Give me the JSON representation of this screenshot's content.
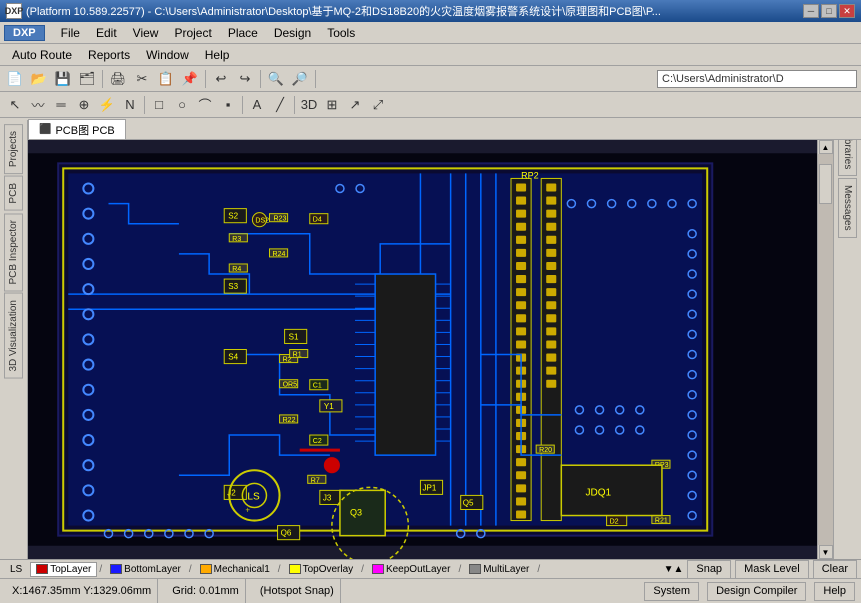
{
  "titlebar": {
    "text": "(Platform 10.589.22577) - C:\\Users\\Administrator\\Desktop\\基于MQ-2和DS18B20的火灾温度烟雾报警系统设计\\原理图和PCB图\\P...",
    "app_icon": "DXP",
    "min_btn": "─",
    "max_btn": "□",
    "close_btn": "✕"
  },
  "menubar": {
    "items": [
      "File",
      "Edit",
      "View",
      "Project",
      "Place",
      "Design",
      "Tools"
    ]
  },
  "dxp": {
    "label": "DXP"
  },
  "menu2": {
    "items": [
      "Auto Route",
      "Reports",
      "Window",
      "Help"
    ]
  },
  "tab": {
    "icon": "⬛",
    "label": "PCB图 PCB"
  },
  "left_panel": {
    "tabs": [
      "Projects",
      "PCB",
      "PCB Inspector",
      "3D Visualization"
    ]
  },
  "right_panel": {
    "tabs": [
      "Libraries",
      "Messages"
    ]
  },
  "layer_tabs": {
    "active": "TopLayer",
    "tabs": [
      {
        "id": "ls",
        "label": "LS",
        "color": null,
        "is_special": true
      },
      {
        "id": "toplayer",
        "label": "TopLayer",
        "color": "#cc0000"
      },
      {
        "id": "bottomlayer",
        "label": "BottomLayer",
        "color": "#1a1aff"
      },
      {
        "id": "mechanical1",
        "label": "Mechanical1",
        "color": "#ffaa00"
      },
      {
        "id": "topoverlay",
        "label": "TopOverlay",
        "color": "#ffff00"
      },
      {
        "id": "keepoutlayer",
        "label": "KeepOutLayer",
        "color": "#ff00ff"
      },
      {
        "id": "multilayer",
        "label": "MultiLayer",
        "color": "#888888"
      }
    ]
  },
  "statusbar": {
    "coords": "X:1467.35mm Y:1329.06mm",
    "grid": "Grid: 0.01mm",
    "snap_mode": "(Hotspot Snap)",
    "system_btn": "System",
    "design_compiler_btn": "Design Compiler",
    "help_btn": "Help",
    "snap_btn": "Snap",
    "mask_level_btn": "Mask Level",
    "clear_btn": "Clear"
  },
  "toolbar": {
    "path": "C:\\Users\\Administrator\\D"
  }
}
